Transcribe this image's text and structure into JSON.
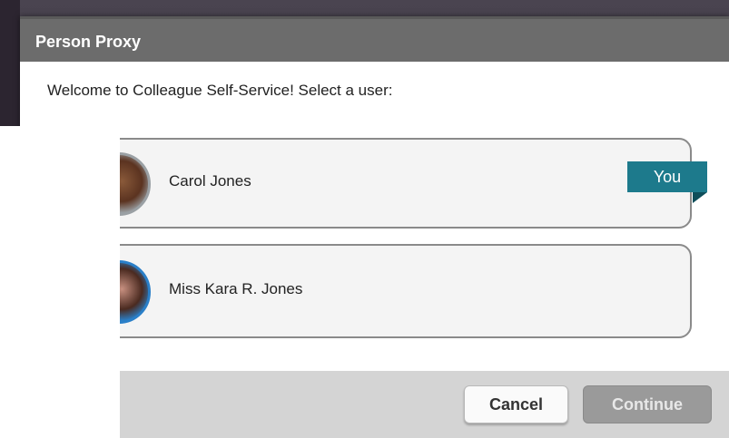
{
  "dialog": {
    "title": "Person Proxy",
    "welcome_text": "Welcome to Colleague Self-Service! Select a user:"
  },
  "users": [
    {
      "name": "Carol Jones",
      "tag": "You",
      "avatar_icon": "avatar-photo"
    },
    {
      "name": "Miss Kara R. Jones",
      "avatar_icon": "avatar-photo"
    }
  ],
  "footer": {
    "cancel_label": "Cancel",
    "continue_label": "Continue"
  },
  "colors": {
    "header_bg": "#6c6c6c",
    "you_tag_bg": "#1d7a8c",
    "footer_bg": "#d4d4d4",
    "continue_disabled_bg": "#9a9a9a"
  }
}
